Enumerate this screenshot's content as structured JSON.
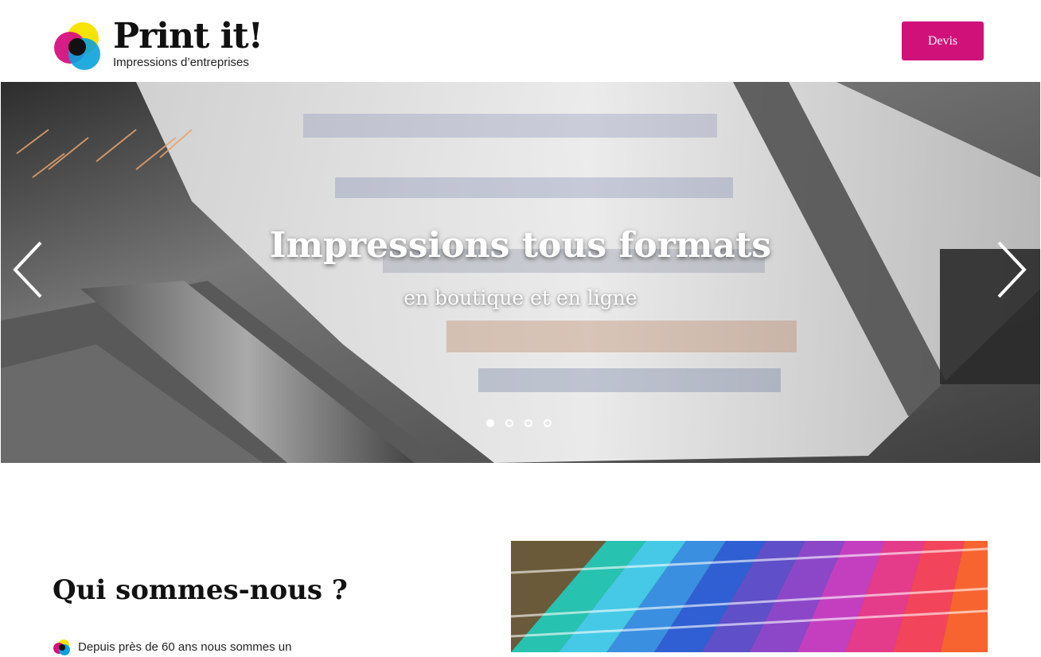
{
  "header": {
    "logo": {
      "title": "Print it!",
      "subtitle": "Impressions d’entreprises"
    },
    "cta_label": "Devis",
    "cta_color": "#d0117a"
  },
  "hero": {
    "title": "Impressions tous formats",
    "subtitle": "en boutique et en ligne",
    "slides_count": 4,
    "active_slide": 1,
    "prev_icon": "chevron-left-icon",
    "next_icon": "chevron-right-icon"
  },
  "about": {
    "title": "Qui sommes-nous ?",
    "text": "Depuis près de 60 ans nous sommes un"
  }
}
